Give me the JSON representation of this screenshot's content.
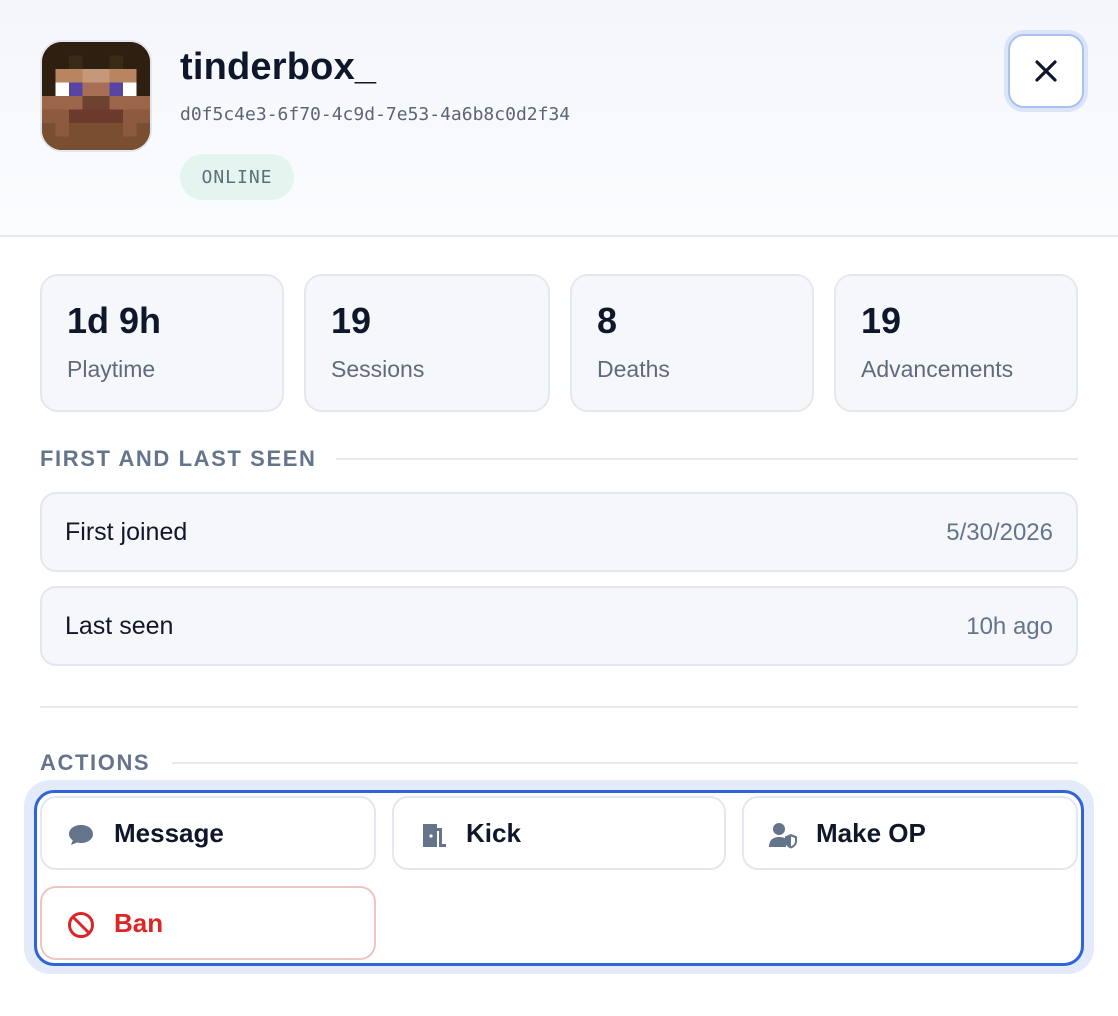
{
  "player": {
    "name": "tinderbox_",
    "uuid": "d0f5c4e3-6f70-4c9d-7e53-4a6b8c0d2f34",
    "status": "ONLINE",
    "avatar_icon": "player-head-avatar"
  },
  "close": {
    "icon": "close-icon"
  },
  "stats": [
    {
      "value": "1d 9h",
      "label": "Playtime"
    },
    {
      "value": "19",
      "label": "Sessions"
    },
    {
      "value": "8",
      "label": "Deaths"
    },
    {
      "value": "19",
      "label": "Advancements"
    }
  ],
  "seen": {
    "title": "FIRST AND LAST SEEN",
    "rows": [
      {
        "label": "First joined",
        "value": "5/30/2026"
      },
      {
        "label": "Last seen",
        "value": "10h ago"
      }
    ]
  },
  "actions": {
    "title": "ACTIONS",
    "buttons": [
      {
        "label": "Message",
        "icon": "chat-bubble-icon"
      },
      {
        "label": "Kick",
        "icon": "door-exit-icon"
      },
      {
        "label": "Make OP",
        "icon": "user-shield-icon"
      },
      {
        "label": "Ban",
        "icon": "ban-icon"
      }
    ]
  },
  "colors": {
    "accent": "#2f63d8",
    "danger": "#dc2626",
    "online_badge_bg": "#e3f5ee",
    "icon_gray": "#64748b"
  }
}
